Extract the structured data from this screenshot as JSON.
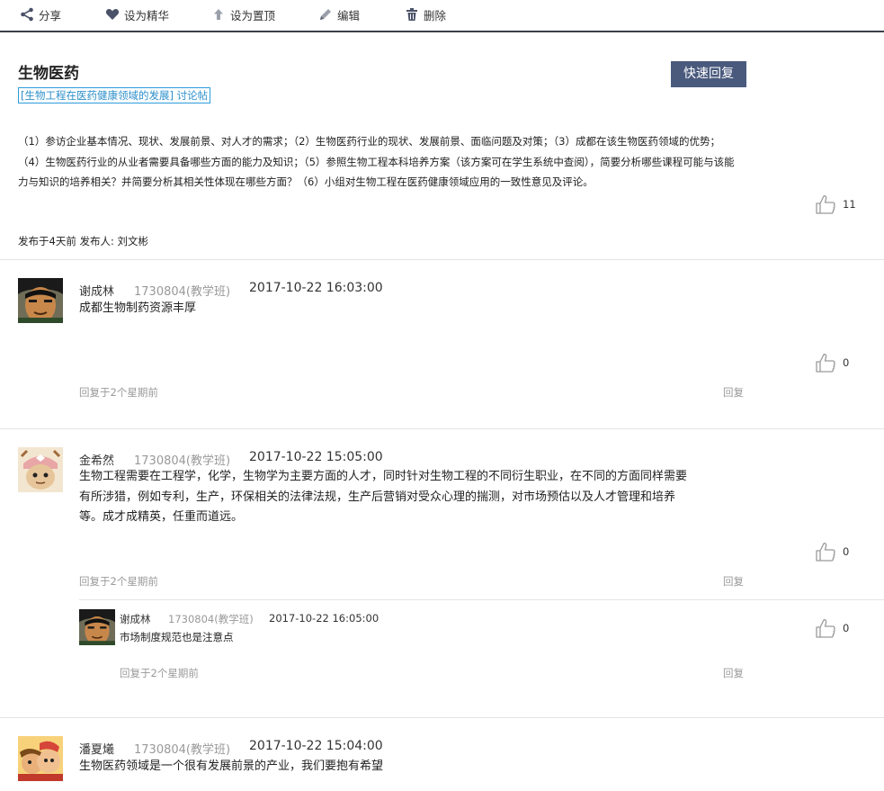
{
  "toolbar": {
    "share": "分享",
    "feature": "设为精华",
    "pin": "设为置顶",
    "edit": "编辑",
    "delete": "删除"
  },
  "post": {
    "title": "生物医药",
    "tag": "[生物工程在医药健康领域的发展] 讨论帖",
    "quick_reply": "快速回复",
    "body_lines": [
      "（1）参访企业基本情况、现状、发展前景、对人才的需求；（2）生物医药行业的现状、发展前景、面临问题及对策；（3）成都在该生物医药领域的优势；",
      "（4）生物医药行业的从业者需要具备哪些方面的能力及知识；（5）参照生物工程本科培养方案（该方案可在学生系统中查阅），简要分析哪些课程可能与该能",
      "力与知识的培养相关？并简要分析其相关性体现在哪些方面？（6）小组对生物工程在医药健康领域应用的一致性意见及评论。"
    ],
    "likes": "11",
    "meta": "发布于4天前 发布人: 刘文彬"
  },
  "comments": [
    {
      "name": "谢成林",
      "id": "1730804(教学班)",
      "time": "2017-10-22 16:03:00",
      "lines": [
        "成都生物制药资源丰厚"
      ],
      "likes": "0",
      "foot": "回复于2个星期前",
      "reply": "回复"
    },
    {
      "name": "金希然",
      "id": "1730804(教学班)",
      "time": "2017-10-22 15:05:00",
      "lines": [
        "生物工程需要在工程学，化学，生物学为主要方面的人才，同时针对生物工程的不同衍生职业，在不同的方面同样需要",
        "有所涉猎，例如专利，生产，环保相关的法律法规，生产后营销对受众心理的揣测，对市场预估以及人才管理和培养",
        "等。成才成精英，任重而道远。"
      ],
      "likes": "0",
      "foot": "回复于2个星期前",
      "reply": "回复",
      "subreply": {
        "name": "谢成林",
        "id": "1730804(教学班)",
        "time": "2017-10-22 16:05:00",
        "text": "市场制度规范也是注意点",
        "likes": "0",
        "foot": "回复于2个星期前",
        "reply": "回复"
      }
    },
    {
      "name": "潘夏爔",
      "id": "1730804(教学班)",
      "time": "2017-10-22 15:04:00",
      "lines": [
        "生物医药领域是一个很有发展前景的产业，我们要抱有希望"
      ]
    }
  ]
}
